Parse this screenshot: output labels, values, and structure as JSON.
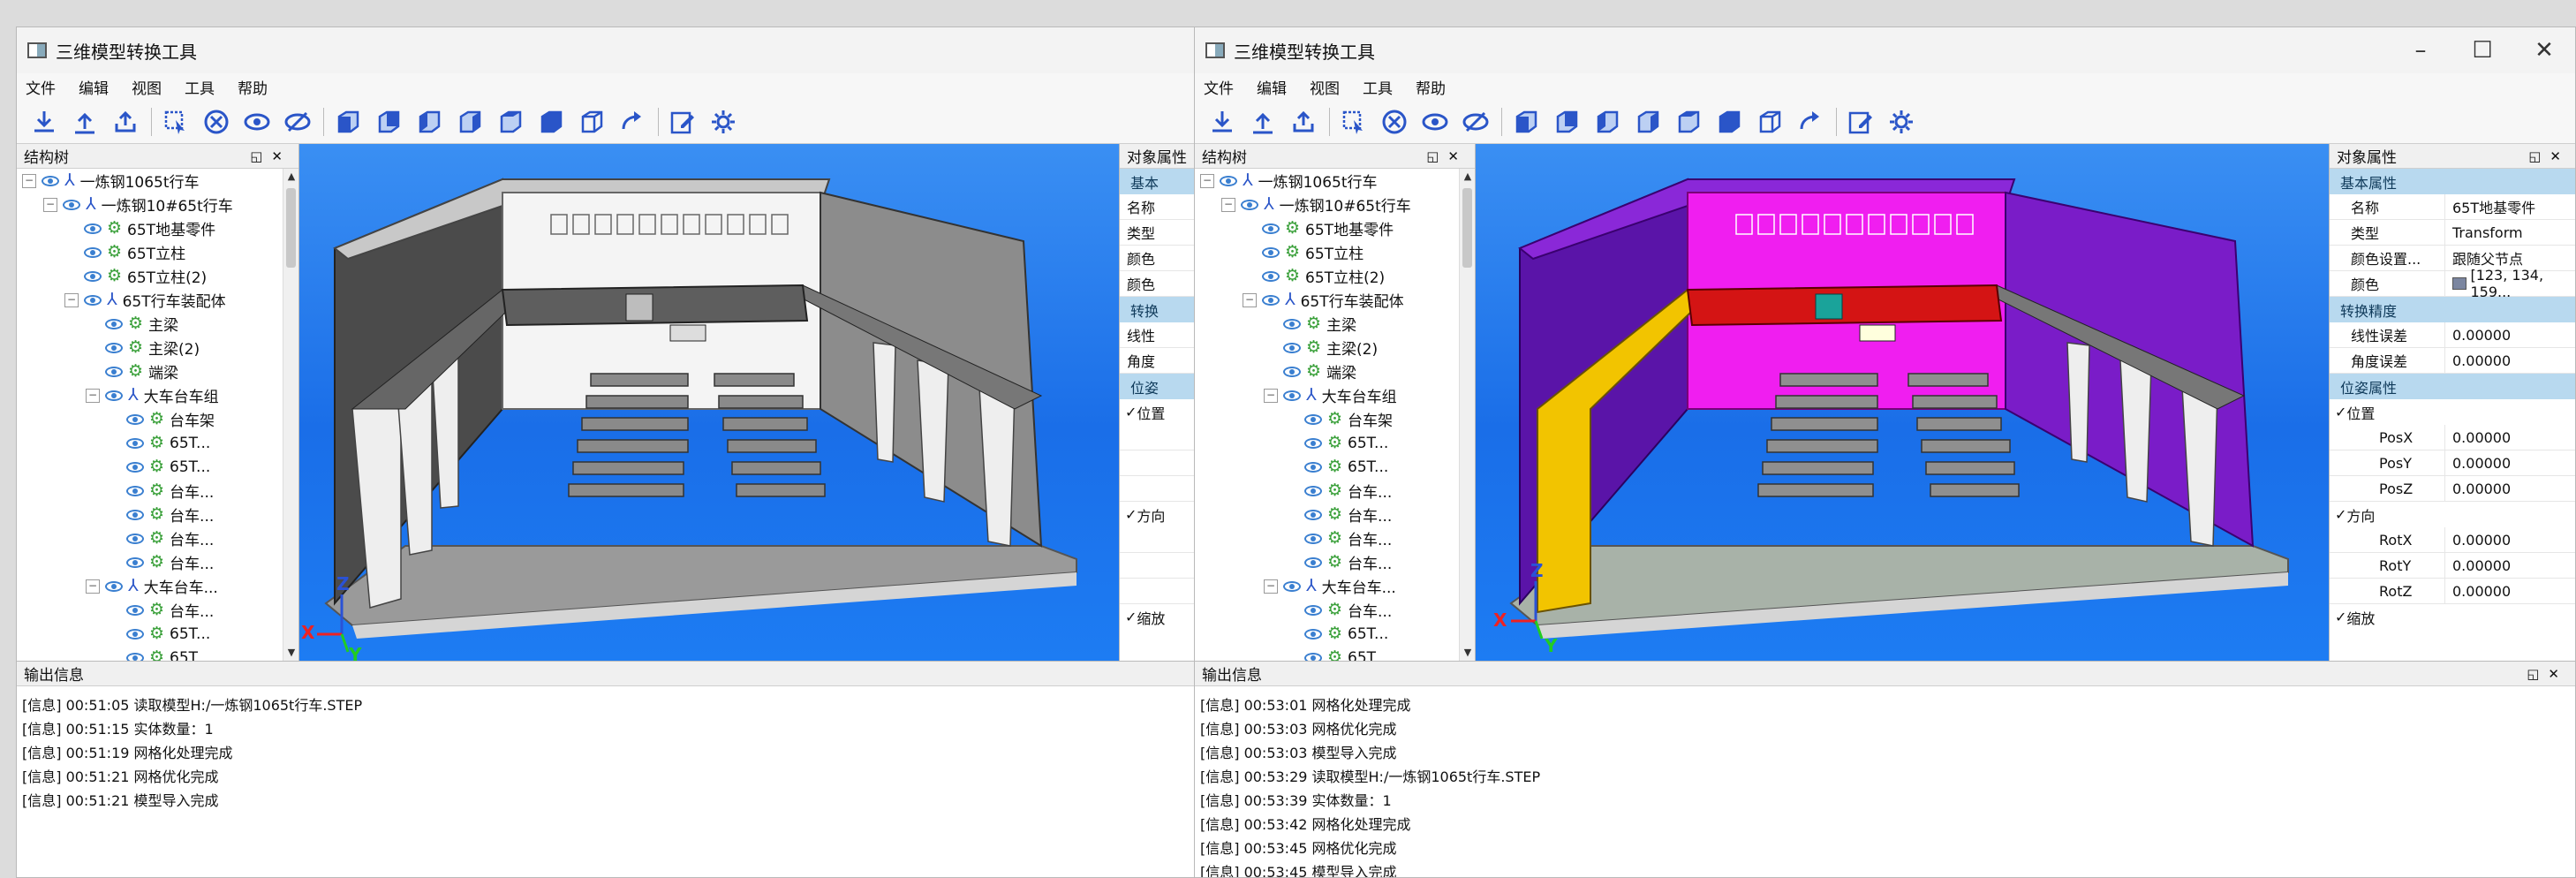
{
  "left": {
    "title": "三维模型转换工具",
    "menu": [
      "文件",
      "编辑",
      "视图",
      "工具",
      "帮助"
    ],
    "tree_title": "结构树",
    "props_title": "对象属性",
    "props_items": [
      {
        "kind": "cat",
        "text": "基本"
      },
      {
        "kind": "row",
        "text": "名称"
      },
      {
        "kind": "row",
        "text": "类型"
      },
      {
        "kind": "row",
        "text": "颜色"
      },
      {
        "kind": "row",
        "text": "颜色"
      },
      {
        "kind": "cat",
        "text": "转换"
      },
      {
        "kind": "row",
        "text": "线性"
      },
      {
        "kind": "row",
        "text": "角度"
      },
      {
        "kind": "cat",
        "text": "位姿"
      },
      {
        "kind": "grp",
        "text": "位置"
      },
      {
        "kind": "blank",
        "text": ""
      },
      {
        "kind": "blank",
        "text": ""
      },
      {
        "kind": "blank",
        "text": ""
      },
      {
        "kind": "grp",
        "text": "方向"
      },
      {
        "kind": "blank",
        "text": ""
      },
      {
        "kind": "blank",
        "text": ""
      },
      {
        "kind": "blank",
        "text": ""
      },
      {
        "kind": "grp",
        "text": "缩放"
      }
    ],
    "output_title": "输出信息",
    "log": [
      "[信息] 00:51:05 读取模型H:/一炼钢1065t行车.STEP",
      "[信息] 00:51:15 实体数量：1",
      "[信息] 00:51:19 网格化处理完成",
      "[信息] 00:51:21 网格优化完成",
      "[信息] 00:51:21 模型导入完成"
    ]
  },
  "right": {
    "title": "三维模型转换工具",
    "menu": [
      "文件",
      "编辑",
      "视图",
      "工具",
      "帮助"
    ],
    "tree_title": "结构树",
    "props_title": "对象属性",
    "props": {
      "cat_basic": "基本属性",
      "name_k": "名称",
      "name_v": "65T地基零件",
      "type_k": "类型",
      "type_v": "Transform",
      "colorset_k": "颜色设置...",
      "colorset_v": "跟随父节点",
      "color_k": "颜色",
      "color_v": "[123, 134, 159...",
      "cat_convert": "转换精度",
      "lin_k": "线性误差",
      "lin_v": "0.00000",
      "ang_k": "角度误差",
      "ang_v": "0.00000",
      "cat_pose": "位姿属性",
      "pos_grp": "位置",
      "posx_k": "PosX",
      "posx_v": "0.00000",
      "posy_k": "PosY",
      "posy_v": "0.00000",
      "posz_k": "PosZ",
      "posz_v": "0.00000",
      "dir_grp": "方向",
      "rotx_k": "RotX",
      "rotx_v": "0.00000",
      "roty_k": "RotY",
      "roty_v": "0.00000",
      "rotz_k": "RotZ",
      "rotz_v": "0.00000",
      "scale_grp": "缩放"
    },
    "output_title": "输出信息",
    "log": [
      "[信息] 00:53:01 网格化处理完成",
      "[信息] 00:53:03 网格优化完成",
      "[信息] 00:53:03 模型导入完成",
      "[信息] 00:53:29 读取模型H:/一炼钢1065t行车.STEP",
      "[信息] 00:53:39 实体数量：1",
      "[信息] 00:53:42 网格化处理完成",
      "[信息] 00:53:45 网格优化完成",
      "[信息] 00:53:45 模型导入完成"
    ]
  },
  "tree": [
    {
      "indent": 0,
      "exp": "−",
      "type": "asm",
      "label": "一炼钢1065t行车"
    },
    {
      "indent": 1,
      "exp": "−",
      "type": "asm",
      "label": "一炼钢10#65t行车"
    },
    {
      "indent": 2,
      "exp": "",
      "type": "part",
      "label": "65T地基零件"
    },
    {
      "indent": 2,
      "exp": "",
      "type": "part",
      "label": "65T立柱"
    },
    {
      "indent": 2,
      "exp": "",
      "type": "part",
      "label": "65T立柱(2)"
    },
    {
      "indent": 2,
      "exp": "−",
      "type": "asm",
      "label": "65T行车装配体"
    },
    {
      "indent": 3,
      "exp": "",
      "type": "part",
      "label": "主梁"
    },
    {
      "indent": 3,
      "exp": "",
      "type": "part",
      "label": "主梁(2)"
    },
    {
      "indent": 3,
      "exp": "",
      "type": "part",
      "label": "端梁"
    },
    {
      "indent": 3,
      "exp": "−",
      "type": "asm",
      "label": "大车台车组"
    },
    {
      "indent": 4,
      "exp": "",
      "type": "part",
      "label": "台车架"
    },
    {
      "indent": 4,
      "exp": "",
      "type": "part",
      "label": "65T..."
    },
    {
      "indent": 4,
      "exp": "",
      "type": "part",
      "label": "65T..."
    },
    {
      "indent": 4,
      "exp": "",
      "type": "part",
      "label": "台车..."
    },
    {
      "indent": 4,
      "exp": "",
      "type": "part",
      "label": "台车..."
    },
    {
      "indent": 4,
      "exp": "",
      "type": "part",
      "label": "台车..."
    },
    {
      "indent": 4,
      "exp": "",
      "type": "part",
      "label": "台车..."
    },
    {
      "indent": 3,
      "exp": "−",
      "type": "asm",
      "label": "大车台车..."
    },
    {
      "indent": 4,
      "exp": "",
      "type": "part",
      "label": "台车..."
    },
    {
      "indent": 4,
      "exp": "",
      "type": "part",
      "label": "65T..."
    },
    {
      "indent": 4,
      "exp": "",
      "type": "part",
      "label": "65T"
    }
  ],
  "toolbar_icons": [
    "import-icon",
    "export-icon",
    "upload-icon",
    "select-icon",
    "cross-circle-icon",
    "show-icon",
    "hide-icon",
    "view-front-icon",
    "view-back-icon",
    "view-left-icon",
    "view-right-icon",
    "view-top-icon",
    "view-bottom-icon",
    "view-iso-icon",
    "rotate-icon",
    "edit-icon",
    "settings-icon"
  ],
  "axes": {
    "x": "X",
    "y": "Y",
    "z": "Z"
  },
  "colors": {
    "accent": "#2a55c8",
    "viewport_bg": "#1f78ee",
    "prop_category": "#b8d9ef"
  }
}
